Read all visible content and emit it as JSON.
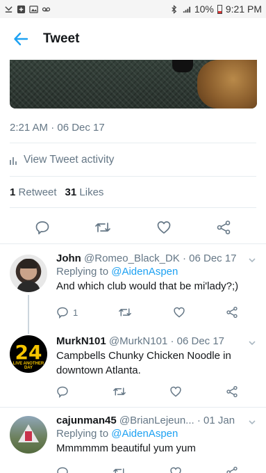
{
  "status_bar": {
    "battery": "10%",
    "time": "9:21 PM",
    "network": "LTE"
  },
  "header": {
    "title": "Tweet"
  },
  "tweet": {
    "timestamp": "2:21 AM · 06 Dec 17",
    "activity_label": "View Tweet activity",
    "retweet_count": "1",
    "retweet_label": "Retweet",
    "like_count": "31",
    "like_label": "Likes"
  },
  "replies": [
    {
      "name": "John",
      "handle": "@Romeo_Black_DK",
      "date": "· 06 Dec 17",
      "replying_prefix": "Replying to",
      "replying_to": "@AidenAspen",
      "text": "And which club would that be mi'lady?;)",
      "reply_count": "1",
      "retweet_count": "",
      "like_count": ""
    },
    {
      "name": "MurkN101",
      "handle": "@MurkN101",
      "date": "· 06 Dec 17",
      "text": "Campbells Chunky Chicken Noodle in downtown Atlanta.",
      "avatar_text": "24",
      "avatar_sub": "LIVE ANOTHER DAY"
    },
    {
      "name": "cajunman45",
      "handle": "@BrianLejeun...",
      "date": "· 01 Jan",
      "replying_prefix": "Replying to",
      "replying_to": "@AidenAspen",
      "text": "Mmmmmm beautiful yum yum"
    }
  ],
  "colors": {
    "accent": "#1da1f2",
    "muted": "#657786",
    "text": "#14171a"
  }
}
